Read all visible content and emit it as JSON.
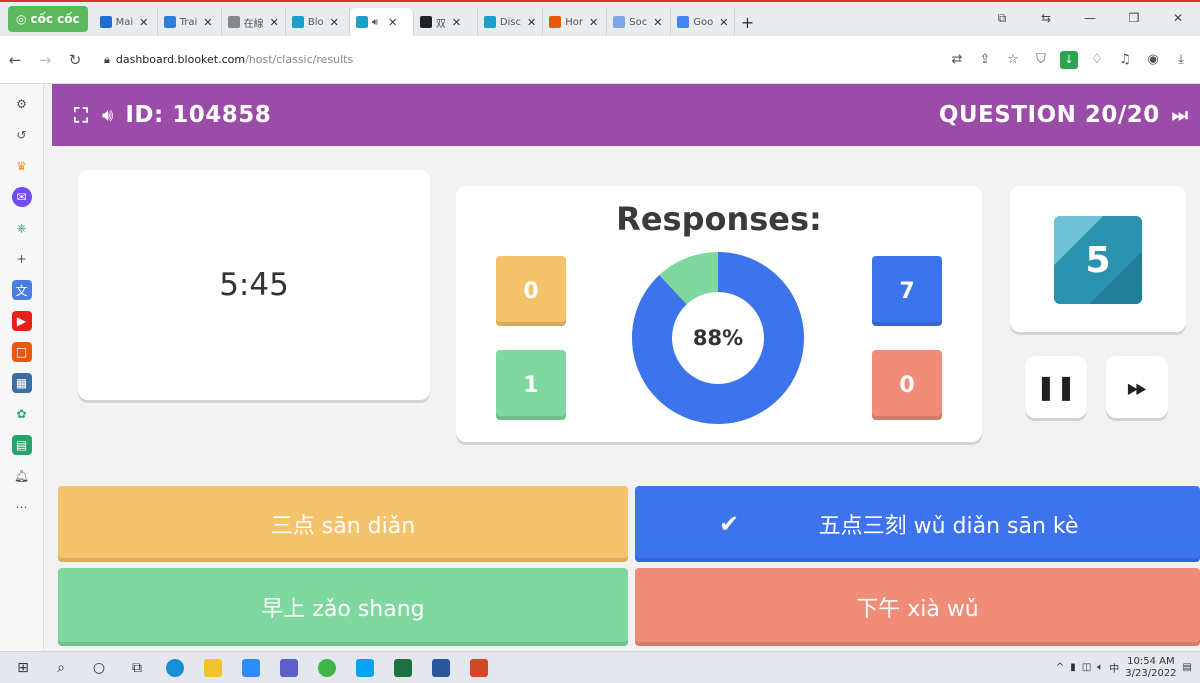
{
  "browser": {
    "brand": "cốc cốc",
    "tabs": [
      {
        "label": "Mai",
        "color": "#1f6fd1"
      },
      {
        "label": "Trai",
        "color": "#2d7fd8"
      },
      {
        "label": "在線",
        "color": "#888888"
      },
      {
        "label": "Blo",
        "color": "#1aa0c8"
      },
      {
        "label": "",
        "color": "#1aa0c8",
        "active": true
      },
      {
        "label": "双",
        "color": "#222222"
      },
      {
        "label": "Disc",
        "color": "#1aa0c8"
      },
      {
        "label": "Hor",
        "color": "#e8590c"
      },
      {
        "label": "Soc",
        "color": "#7aa7e8"
      },
      {
        "label": "Goo",
        "color": "#4285f4"
      }
    ],
    "address": {
      "host": "dashboard.blooket.com",
      "path": "/host/classic/results"
    }
  },
  "header": {
    "game_id": "ID: 104858",
    "question": "QUESTION 20/20"
  },
  "timer": "5:45",
  "responses": {
    "title": "Responses:",
    "counts": {
      "yellow": "0",
      "green": "1",
      "blue": "7",
      "red": "0"
    },
    "percent_correct": 88,
    "percent_label": "88%"
  },
  "questions_left": "5",
  "answers": {
    "yellow": "三点 sān diǎn",
    "blue": "五点三刻 wǔ diǎn sān kè",
    "green": "早上 zǎo shang",
    "red": "下午 xià wǔ"
  },
  "colors": {
    "header": "#9a4ca8",
    "yellow": "#f4c36b",
    "blue": "#3e73ee",
    "green": "#7ed89f",
    "red": "#f18c78"
  },
  "taskbar": {
    "time": "10:54 AM",
    "date": "3/23/2022"
  }
}
